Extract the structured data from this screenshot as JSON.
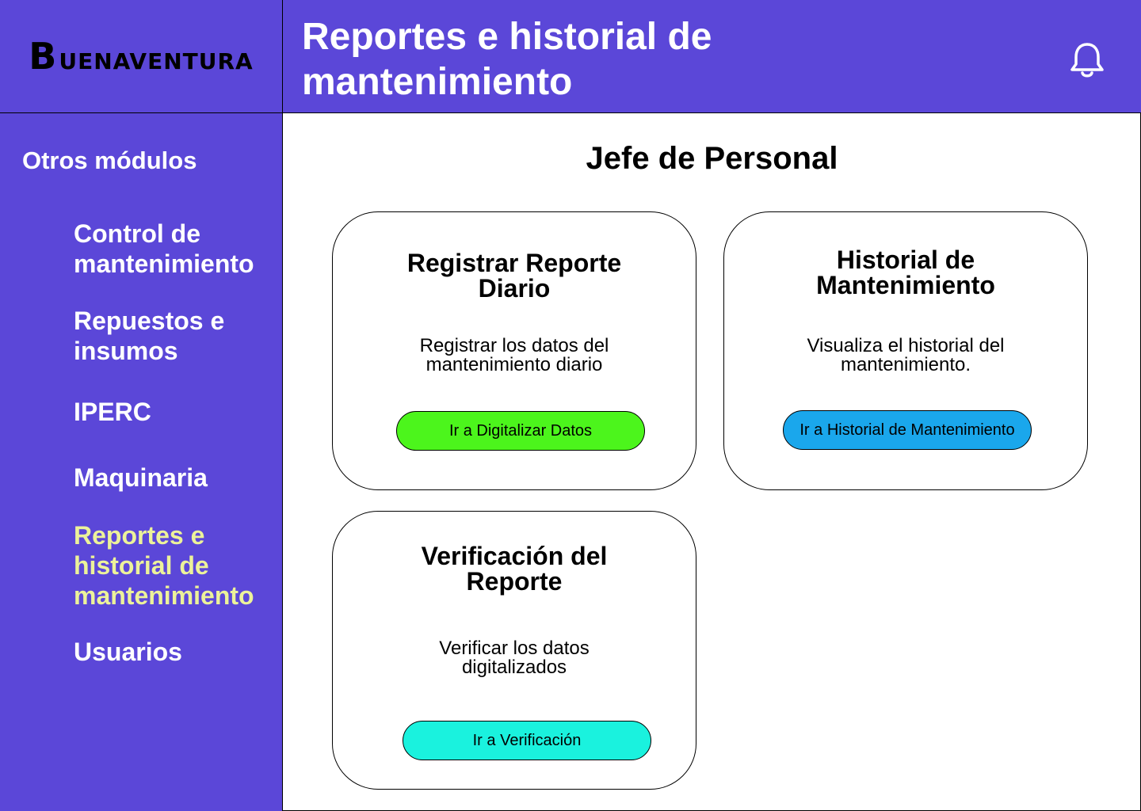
{
  "app": {
    "logo_initial": "B",
    "logo_rest": "UENAVENTURA"
  },
  "header": {
    "title": "Reportes e historial de mantenimiento"
  },
  "sidebar": {
    "heading": "Otros módulos",
    "items": [
      {
        "label": "Control de mantenimiento"
      },
      {
        "label": "Repuestos e insumos"
      },
      {
        "label": "IPERC"
      },
      {
        "label": "Maquinaria"
      },
      {
        "label": "Reportes e historial de mantenimiento",
        "active": true
      },
      {
        "label": "Usuarios"
      }
    ]
  },
  "main": {
    "title": "Jefe de Personal",
    "cards": [
      {
        "title": "Registrar Reporte Diario",
        "description": "Registrar los datos del mantenimiento diario",
        "button": "Ir a Digitalizar Datos",
        "button_color": "#4cf51c"
      },
      {
        "title": "Historial de Mantenimiento",
        "description": "Visualiza el historial del mantenimiento.",
        "button": "Ir a Historial de Mantenimiento",
        "button_color": "#1aa7ec"
      },
      {
        "title": "Verificación del Reporte",
        "description": "Verificar los datos digitalizados",
        "button": "Ir a Verificación",
        "button_color": "#1af2de"
      }
    ]
  },
  "colors": {
    "primary": "#5b47d8",
    "active_nav": "#ecf29a"
  },
  "icons": {
    "notification": "bell-icon"
  }
}
